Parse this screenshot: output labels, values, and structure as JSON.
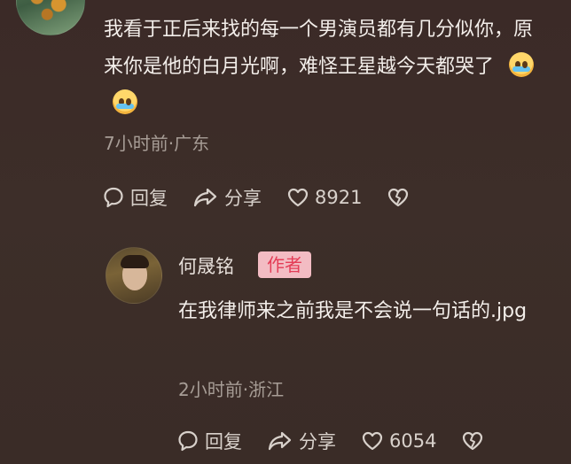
{
  "main_comment": {
    "text": "我看于正后来找的每一个男演员都有几分似你，原来你是他的白月光啊，难怪王星越今天都哭了",
    "meta": "7小时前·广东",
    "reply_label": "回复",
    "share_label": "分享",
    "like_count": "8921"
  },
  "reply": {
    "author": "何晟铭",
    "badge": "作者",
    "text": "在我律师来之前我是不会说一句话的.jpg",
    "meta": "2小时前·浙江",
    "reply_label": "回复",
    "share_label": "分享",
    "like_count": "6054"
  },
  "icons": [
    "comment-icon",
    "share-icon",
    "heart-icon",
    "broken-heart-icon"
  ]
}
